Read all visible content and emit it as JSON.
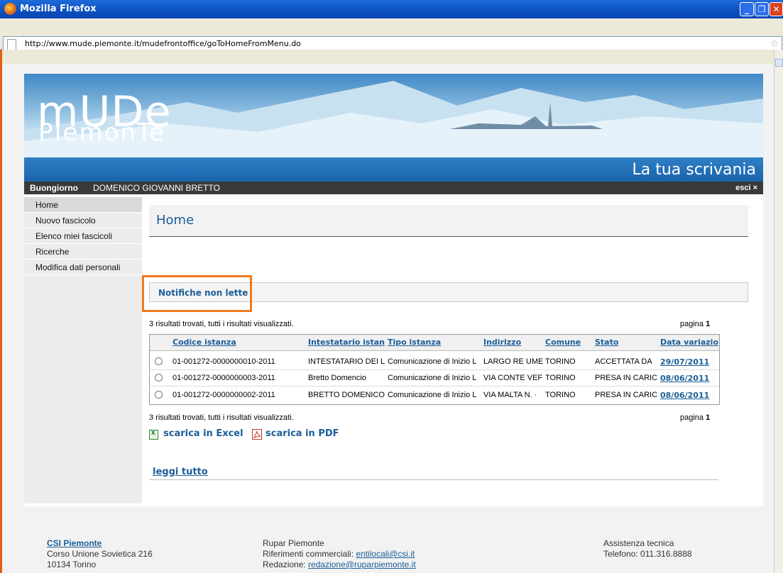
{
  "window": {
    "title": "Mozilla Firefox"
  },
  "browser": {
    "url": "http://www.mude.piemonte.it/mudefrontoffice/goToHomeFromMenu.do"
  },
  "banner": {
    "logo_top": "mUDe",
    "logo_bottom": "PIemonTe",
    "section_title": "La tua scrivania"
  },
  "userbar": {
    "greeting": "Buongiorno",
    "user_name": "DOMENICO GIOVANNI BRETTO",
    "logout": "esci ×"
  },
  "sidebar": {
    "items": [
      "Home",
      "Nuovo fascicolo",
      "Elenco miei fascicoli",
      "Ricerche",
      "Modifica dati personali"
    ]
  },
  "main": {
    "title": "Home",
    "notifications_title": "Notifiche non lette",
    "results_text": "3 risultati trovati, tutti i risultati visualizzati.",
    "page_label": "pagina",
    "page_number": "1",
    "columns": [
      "Codice istanza",
      "Intestatario istanz",
      "Tipo istanza",
      "Indirizzo",
      "Comune",
      "Stato",
      "Data variazion"
    ],
    "rows": [
      [
        "01-001272-0000000010-2011",
        "INTESTATARIO DEI L",
        "Comunicazione di Inizio L",
        "LARGO RE UME",
        "TORINO",
        "ACCETTATA DA",
        "29/07/2011"
      ],
      [
        "01-001272-0000000003-2011",
        "Bretto Domencio",
        "Comunicazione di Inizio L",
        "VIA CONTE VEF",
        "TORINO",
        "PRESA IN CARIC",
        "08/06/2011"
      ],
      [
        "01-001272-0000000002-2011",
        "BRETTO DOMENICO",
        "Comunicazione di Inizio L",
        "VIA MALTA N. ·",
        "TORINO",
        "PRESA IN CARIC",
        "08/06/2011"
      ]
    ],
    "download_excel": "scarica in Excel",
    "download_pdf": "scarica in PDF",
    "read_all": "leggi tutto"
  },
  "footer": {
    "org_name": "CSI Piemonte",
    "org_address1": "Corso Unione Sovietica 216",
    "org_address2": "10134 Torino",
    "rupar_title": "Rupar Piemonte",
    "rupar_commercial_label": "Riferimenti commerciali:",
    "rupar_commercial_email": "entilocali@csi.it",
    "rupar_editorial_label": "Redazione:",
    "rupar_editorial_email": "redazione@ruparpiemonte.it",
    "support_title": "Assistenza tecnica",
    "support_phone": "Telefono: 011.316.8888"
  },
  "colors": {
    "accent": "#1b5e99",
    "highlight": "#f07a1e",
    "titlebar": "#0a4fc0"
  }
}
